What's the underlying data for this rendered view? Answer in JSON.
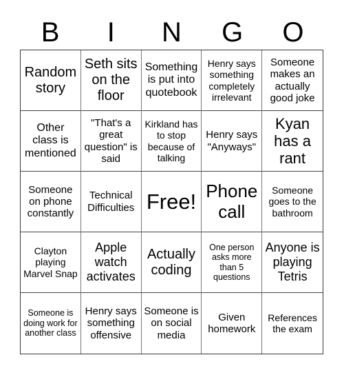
{
  "header": {
    "letters": [
      "B",
      "I",
      "N",
      "G",
      "O"
    ]
  },
  "cells": [
    [
      "Random story",
      "Seth sits on the floor",
      "Something is put into quotebook",
      "Henry says something completely irrelevant",
      "Someone makes an actually good joke"
    ],
    [
      "Other class is mentioned",
      "\"That's a great question\" is said",
      "Kirkland has to stop because of talking",
      "Henry says \"Anyways\"",
      "Kyan has a rant"
    ],
    [
      "Someone on phone constantly",
      "Technical Difficulties",
      "Free!",
      "Phone call",
      "Someone goes to the bathroom"
    ],
    [
      "Clayton playing Marvel Snap",
      "Apple watch activates",
      "Actually coding",
      "One person asks more than 5 questions",
      "Anyone is playing Tetris"
    ],
    [
      "Someone is doing work for another class",
      "Henry says something offensive",
      "Someone is on social media",
      "Given homework",
      "References the exam"
    ]
  ]
}
